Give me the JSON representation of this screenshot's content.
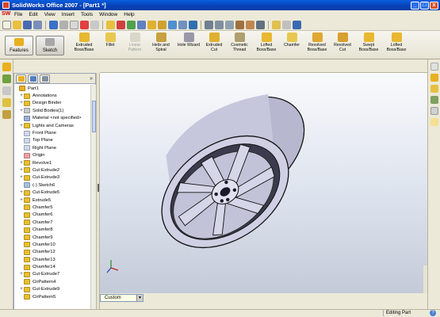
{
  "window": {
    "title": "SolidWorks Office 2007 - [Part1 *]",
    "minimize": "_",
    "maximize": "□",
    "close": "x"
  },
  "menu": {
    "logo": "SW",
    "items": [
      "File",
      "Edit",
      "View",
      "Insert",
      "Tools",
      "Window",
      "Help"
    ]
  },
  "command_manager": {
    "tabs": [
      {
        "label": "Features",
        "icon": "features-icon"
      },
      {
        "label": "Sketch",
        "icon": "sketch-icon"
      }
    ],
    "tools": [
      {
        "label": "Extruded\nBoss/Base",
        "icon": "extruded-boss-icon",
        "enabled": true
      },
      {
        "label": "Fillet",
        "icon": "fillet-icon",
        "enabled": true
      },
      {
        "label": "Linear\nPattern",
        "icon": "linear-pattern-icon",
        "enabled": false
      },
      {
        "label": "Helix and\nSpiral",
        "icon": "helix-icon",
        "enabled": true
      },
      {
        "label": "Hole Wizard",
        "icon": "hole-wizard-icon",
        "enabled": true
      },
      {
        "label": "Extruded\nCut",
        "icon": "extruded-cut-icon",
        "enabled": true
      },
      {
        "label": "Cosmetic\nThread",
        "icon": "cosmetic-thread-icon",
        "enabled": true
      },
      {
        "label": "Lofted\nBoss/Base",
        "icon": "lofted-boss-icon",
        "enabled": true
      },
      {
        "label": "Chamfer",
        "icon": "chamfer-icon",
        "enabled": true
      },
      {
        "label": "Revolved\nBoss/Base",
        "icon": "revolved-boss-icon",
        "enabled": true
      },
      {
        "label": "Revolved\nCut",
        "icon": "revolved-cut-icon",
        "enabled": true
      },
      {
        "label": "Swept\nBoss/Base",
        "icon": "swept-boss-icon",
        "enabled": true
      },
      {
        "label": "Lofted\nBoss/Base",
        "icon": "lofted-boss-2-icon",
        "enabled": true
      }
    ]
  },
  "feature_tree": {
    "collapse_arrow": "»",
    "items": [
      {
        "label": "Part1",
        "level": 0,
        "expander": "",
        "color": "#e8b020"
      },
      {
        "label": "Annotations",
        "level": 1,
        "expander": "+",
        "color": "#e8c030"
      },
      {
        "label": "Design Binder",
        "level": 1,
        "expander": "+",
        "color": "#e8c030"
      },
      {
        "label": "Solid Bodies(1)",
        "level": 1,
        "expander": "+",
        "color": "#c8c8c8"
      },
      {
        "label": "Material <not specified>",
        "level": 1,
        "expander": "",
        "color": "#9ab0d8"
      },
      {
        "label": "Lights and Cameras",
        "level": 1,
        "expander": "+",
        "color": "#e8c030"
      },
      {
        "label": "Front Plane",
        "level": 1,
        "expander": "",
        "color": "#d0d8ec"
      },
      {
        "label": "Top Plane",
        "level": 1,
        "expander": "",
        "color": "#d0d8ec"
      },
      {
        "label": "Right Plane",
        "level": 1,
        "expander": "",
        "color": "#d0d8ec"
      },
      {
        "label": "Origin",
        "level": 1,
        "expander": "",
        "color": "#f0a0a0"
      },
      {
        "label": "Revolve1",
        "level": 1,
        "expander": "+",
        "color": "#e8c030"
      },
      {
        "label": "Cut-Extrude2",
        "level": 1,
        "expander": "+",
        "color": "#e8c030"
      },
      {
        "label": "Cut-Extrude3",
        "level": 1,
        "expander": "+",
        "color": "#e8c030"
      },
      {
        "label": "(-) Sketch6",
        "level": 1,
        "expander": "",
        "color": "#a8c0e0"
      },
      {
        "label": "Cut-Extrude5",
        "level": 1,
        "expander": "+",
        "color": "#e8c030"
      },
      {
        "label": "Extrude5",
        "level": 1,
        "expander": "+",
        "color": "#e8c030"
      },
      {
        "label": "Chamfer5",
        "level": 1,
        "expander": "",
        "color": "#e8c030"
      },
      {
        "label": "Chamfer6",
        "level": 1,
        "expander": "",
        "color": "#e8c030"
      },
      {
        "label": "Chamfer7",
        "level": 1,
        "expander": "",
        "color": "#e8c030"
      },
      {
        "label": "Chamfer8",
        "level": 1,
        "expander": "",
        "color": "#e8c030"
      },
      {
        "label": "Chamfer9",
        "level": 1,
        "expander": "",
        "color": "#e8c030"
      },
      {
        "label": "Chamfer10",
        "level": 1,
        "expander": "",
        "color": "#e8c030"
      },
      {
        "label": "Chamfer12",
        "level": 1,
        "expander": "",
        "color": "#e8c030"
      },
      {
        "label": "Chamfer13",
        "level": 1,
        "expander": "",
        "color": "#e8c030"
      },
      {
        "label": "Chamfer14",
        "level": 1,
        "expander": "",
        "color": "#e8c030"
      },
      {
        "label": "Cut-Extrude7",
        "level": 1,
        "expander": "+",
        "color": "#e8c030"
      },
      {
        "label": "CirPattern4",
        "level": 1,
        "expander": "",
        "color": "#e8c030"
      },
      {
        "label": "Cut-Extrude9",
        "level": 1,
        "expander": "+",
        "color": "#e8c030"
      },
      {
        "label": "CirPattern5",
        "level": 1,
        "expander": "",
        "color": "#e8c030"
      }
    ]
  },
  "viewport": {
    "view_orientation": "Custom"
  },
  "status": {
    "text": "Editing Part",
    "help": "?"
  },
  "colors": {
    "titlebar": "#0a4fd0",
    "wheel_face": "#c7c8de",
    "wheel_edge": "#1a1a2a",
    "viewport_top": "#f9fafc",
    "viewport_bottom": "#c4cbd8"
  }
}
